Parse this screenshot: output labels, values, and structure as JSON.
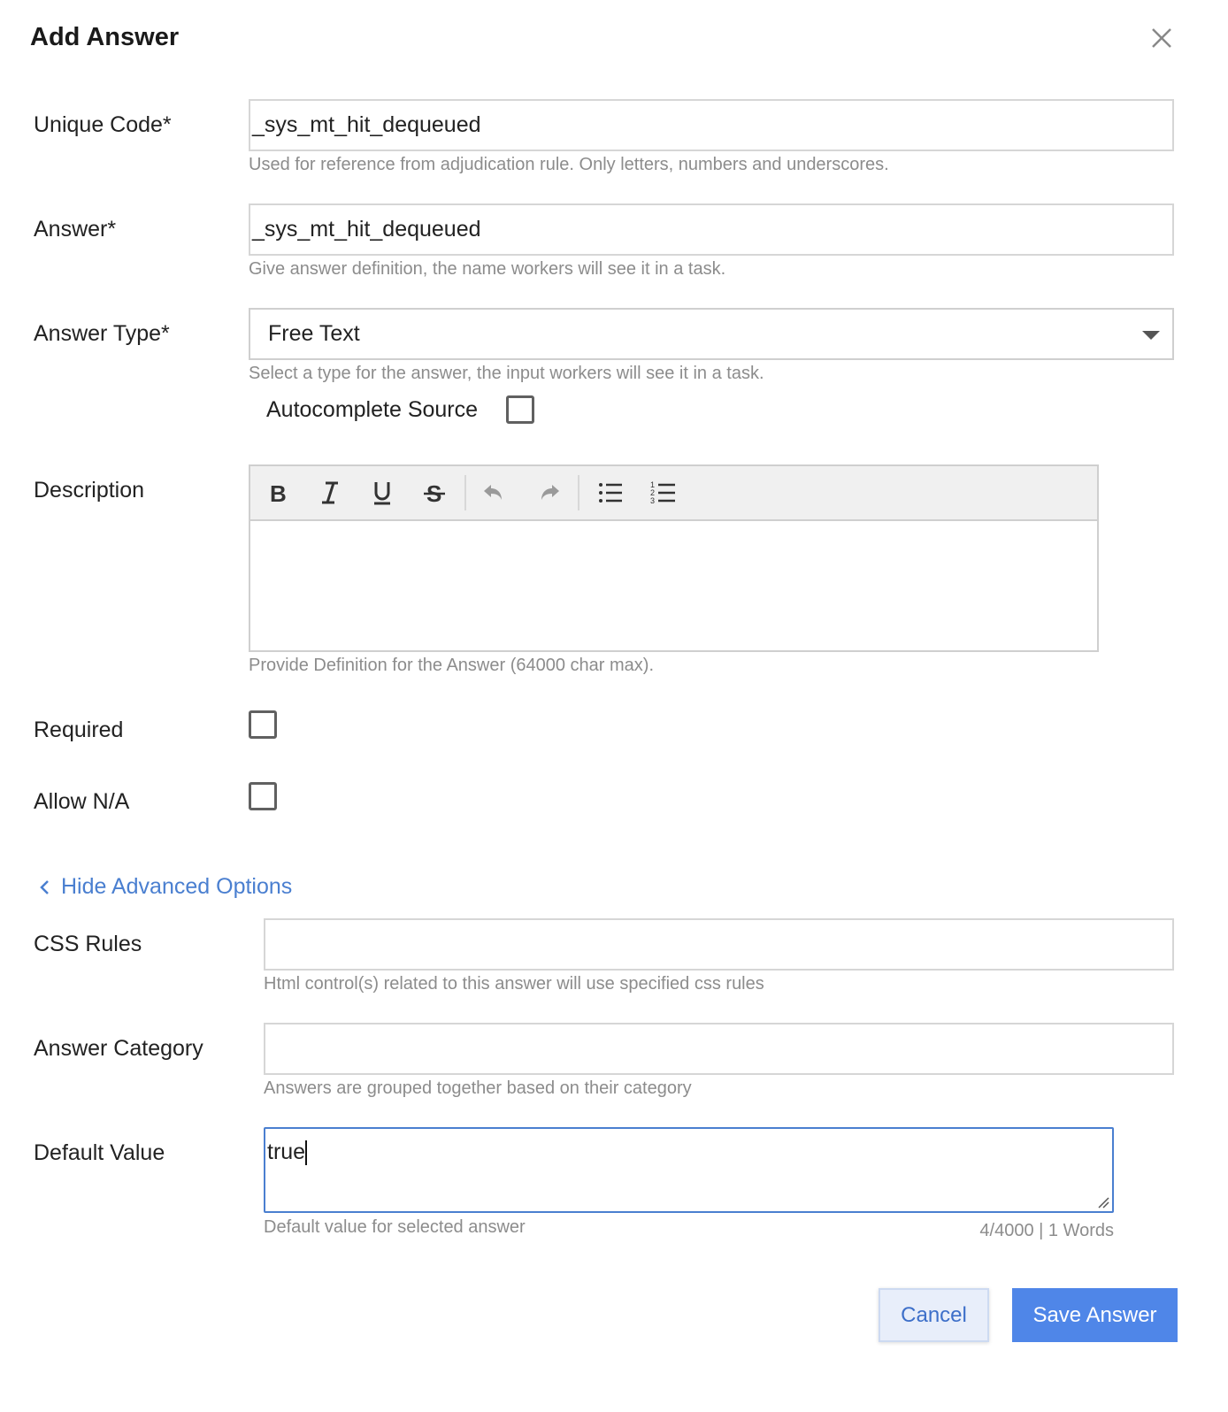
{
  "dialog": {
    "title": "Add Answer",
    "close_icon": "close-icon"
  },
  "fields": {
    "unique_code": {
      "label": "Unique Code*",
      "value": "_sys_mt_hit_dequeued",
      "help": "Used for reference from adjudication rule. Only letters, numbers and underscores."
    },
    "answer": {
      "label": "Answer*",
      "value": "_sys_mt_hit_dequeued",
      "help": "Give answer definition, the name workers will see it in a task."
    },
    "answer_type": {
      "label": "Answer Type*",
      "selected": "Free Text",
      "help": "Select a type for the answer, the input workers will see it in a task.",
      "autocomplete_label": "Autocomplete Source",
      "autocomplete_checked": false
    },
    "description": {
      "label": "Description",
      "help": "Provide Definition for the Answer (64000 char max).",
      "toolbar": [
        "bold-icon",
        "italic-icon",
        "underline-icon",
        "strikethrough-icon",
        "undo-icon",
        "redo-icon",
        "bulleted-list-icon",
        "numbered-list-icon"
      ]
    },
    "required": {
      "label": "Required",
      "checked": false
    },
    "allow_na": {
      "label": "Allow N/A",
      "checked": false
    }
  },
  "advanced": {
    "toggle_label": "Hide Advanced Options",
    "css_rules": {
      "label": "CSS Rules",
      "value": "",
      "help": "Html control(s) related to this answer will use specified css rules"
    },
    "answer_category": {
      "label": "Answer Category",
      "value": "",
      "help": "Answers are grouped together based on their category"
    },
    "default_value": {
      "label": "Default Value",
      "value": "true",
      "help": "Default value for selected answer",
      "counter": "4/4000 | 1 Words"
    }
  },
  "buttons": {
    "cancel": "Cancel",
    "save": "Save Answer"
  },
  "colors": {
    "accent": "#4f86e8",
    "link": "#4a7fd0",
    "help_text": "#8c8c8c"
  }
}
